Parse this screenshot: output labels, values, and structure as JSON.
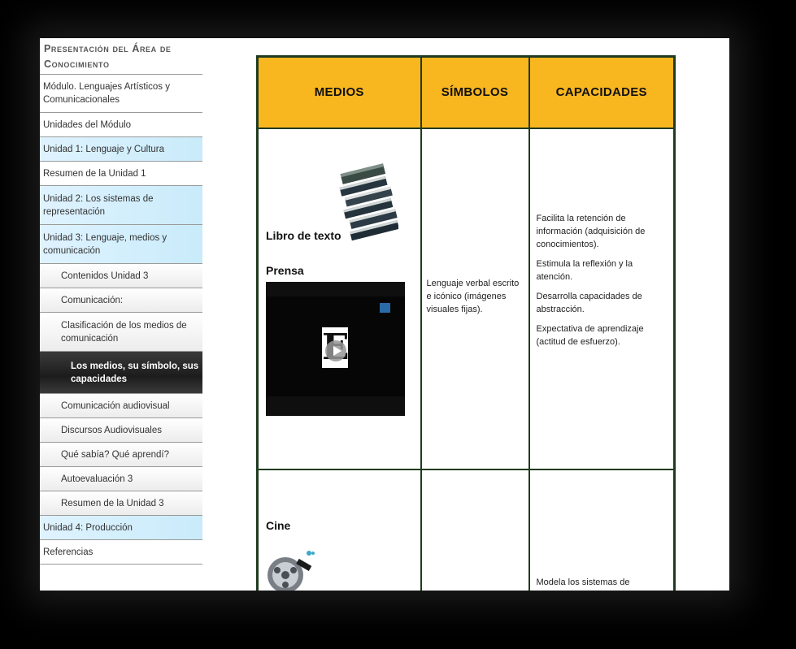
{
  "sidebar": {
    "title": "Presentación del Área de Conocimiento",
    "items": [
      {
        "label": "Módulo. Lenguajes Artísticos y Comunicacionales"
      },
      {
        "label": "Unidades del Módulo"
      },
      {
        "label": "Unidad 1: Lenguaje y Cultura"
      },
      {
        "label": "Resumen de la Unidad 1"
      },
      {
        "label": "Unidad 2: Los sistemas de representación"
      },
      {
        "label": "Unidad 3: Lenguaje, medios y comunicación"
      },
      {
        "label": "Contenidos Unidad 3"
      },
      {
        "label": "Comunicación:"
      },
      {
        "label": "Clasificación de los medios de comunicación"
      },
      {
        "label": "Los medios, su símbolo, sus capacidades"
      },
      {
        "label": "Comunicación audiovisual"
      },
      {
        "label": "Discursos Audiovisuales"
      },
      {
        "label": "Qué sabía? Qué aprendí?"
      },
      {
        "label": "Autoevaluación 3"
      },
      {
        "label": "Resumen de la Unidad 3"
      },
      {
        "label": "Unidad 4: Producción"
      },
      {
        "label": "Referencias"
      }
    ]
  },
  "table": {
    "headers": [
      "MEDIOS",
      "SÍMBOLOS",
      "CAPACIDADES"
    ],
    "row1": {
      "medio1": "Libro de texto",
      "medio2": "Prensa",
      "simbolos": "Lenguaje verbal escrito e icónico (imágenes visuales fijas).",
      "capacidades": [
        "Facilita la retención de información (adquisición de conocimientos).",
        "Estimula la reflexión y la atención.",
        "Desarrolla capacidades de abstracción.",
        "Expectativa de aprendizaje (actitud de esfuerzo)."
      ]
    },
    "row2": {
      "medio1": "Cine",
      "capacidades_partial": "Modela los sistemas de"
    }
  },
  "video": {
    "letter": "E"
  },
  "colors": {
    "header_bg": "#f8b61f",
    "table_border": "#1f3b1f",
    "active_item_bg": "#1c1c1c",
    "unit_item_bg": "#d4eefb"
  },
  "icons": [
    "books-icon",
    "play-icon",
    "film-reel-icon"
  ]
}
